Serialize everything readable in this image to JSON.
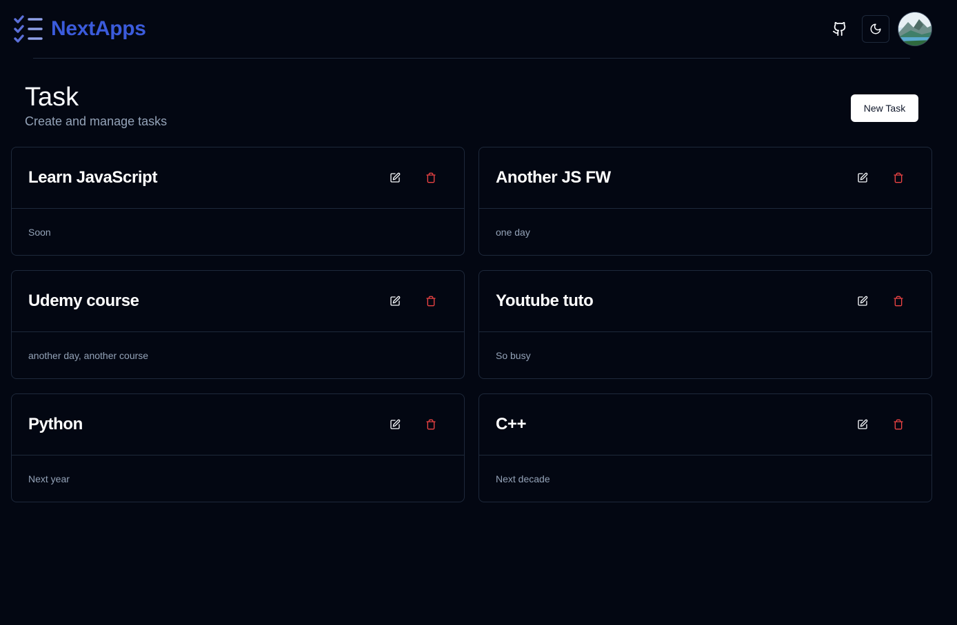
{
  "brand": {
    "name": "NextApps",
    "color": "#3b5bdb"
  },
  "nav": {
    "github_icon": "github-icon",
    "theme_icon": "moon-icon",
    "avatar": "user-avatar"
  },
  "page": {
    "title": "Task",
    "subtitle": "Create and manage tasks",
    "new_task_label": "New Task"
  },
  "tasks": [
    {
      "title": "Learn JavaScript",
      "description": "Soon"
    },
    {
      "title": "Another JS FW",
      "description": "one day"
    },
    {
      "title": "Udemy course",
      "description": "another day, another course"
    },
    {
      "title": "Youtube tuto",
      "description": "So busy"
    },
    {
      "title": "Python",
      "description": "Next year"
    },
    {
      "title": "C++",
      "description": "Next decade"
    }
  ],
  "colors": {
    "background": "#030712",
    "border": "#1e293b",
    "delete": "#ef4444",
    "muted_text": "#94a3b8"
  }
}
